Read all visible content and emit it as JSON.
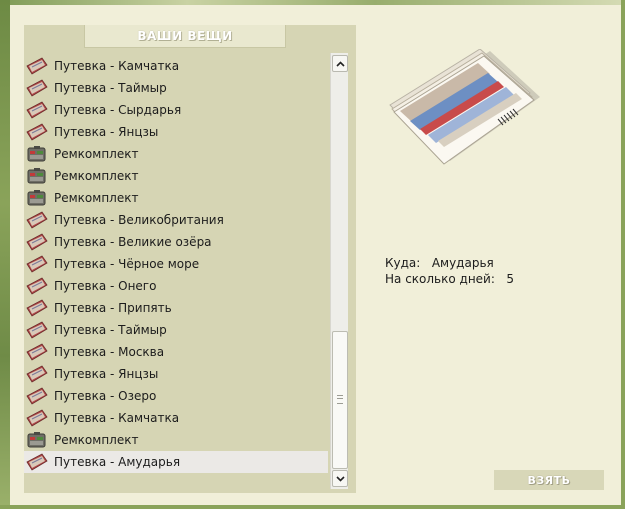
{
  "panel": {
    "title": "ВАШИ ВЕЩИ"
  },
  "items": [
    {
      "label": "Путевка - Камчатка",
      "icon": "ticket-icon"
    },
    {
      "label": "Путевка - Таймыр",
      "icon": "ticket-icon"
    },
    {
      "label": "Путевка - Сырдарья",
      "icon": "ticket-icon"
    },
    {
      "label": "Путевка - Янцзы",
      "icon": "ticket-icon"
    },
    {
      "label": "Ремкомплект",
      "icon": "repair-kit-icon"
    },
    {
      "label": "Ремкомплект",
      "icon": "repair-kit-icon"
    },
    {
      "label": "Ремкомплект",
      "icon": "repair-kit-icon"
    },
    {
      "label": "Путевка - Великобритания",
      "icon": "ticket-icon"
    },
    {
      "label": "Путевка - Великие озёра",
      "icon": "ticket-icon"
    },
    {
      "label": "Путевка - Чёрное море",
      "icon": "ticket-icon"
    },
    {
      "label": "Путевка - Онего",
      "icon": "ticket-icon"
    },
    {
      "label": "Путевка - Припять",
      "icon": "ticket-icon"
    },
    {
      "label": "Путевка - Таймыр",
      "icon": "ticket-icon"
    },
    {
      "label": "Путевка - Москва",
      "icon": "ticket-icon"
    },
    {
      "label": "Путевка - Янцзы",
      "icon": "ticket-icon"
    },
    {
      "label": "Путевка - Озеро",
      "icon": "ticket-icon"
    },
    {
      "label": "Путевка - Камчатка",
      "icon": "ticket-icon"
    },
    {
      "label": "Ремкомплект",
      "icon": "repair-kit-icon"
    },
    {
      "label": "Путевка - Амударья",
      "icon": "ticket-icon",
      "selected": true
    }
  ],
  "details": {
    "destination_label": "Куда:",
    "destination_value": "Амударья",
    "days_label": "На сколько дней:",
    "days_value": "5"
  },
  "actions": {
    "take_label": "ВЗЯТЬ"
  },
  "colors": {
    "panel_bg": "#d6d5b4",
    "page_bg": "#f1efd9",
    "selected_row": "#ebe9e6"
  }
}
